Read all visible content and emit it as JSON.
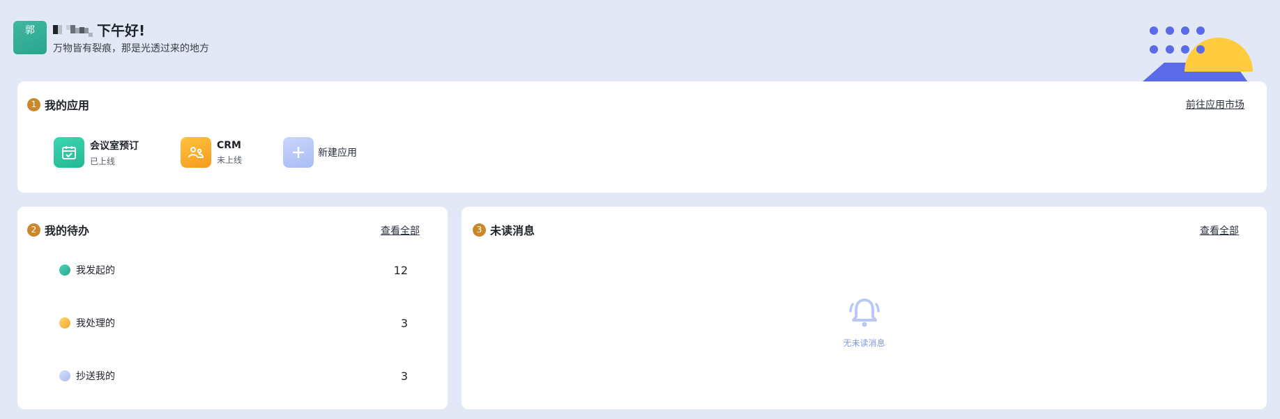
{
  "header": {
    "avatar_text": "郭",
    "greeting": "下午好!",
    "motto": "万物皆有裂痕，那是光透过来的地方"
  },
  "apps_section": {
    "number": "1",
    "title": "我的应用",
    "market_link": "前往应用市场",
    "apps": [
      {
        "name": "会议室预订",
        "status": "已上线",
        "icon": "calendar-check-icon",
        "color": "#2fc4a0"
      },
      {
        "name": "CRM",
        "status": "未上线",
        "icon": "users-icon",
        "color": "#f7a728"
      }
    ],
    "new_app_label": "新建应用"
  },
  "todo_section": {
    "number": "2",
    "title": "我的待办",
    "view_all": "查看全部",
    "items": [
      {
        "label": "我发起的",
        "count": "12",
        "color": "#2fb59a"
      },
      {
        "label": "我处理的",
        "count": "3",
        "color": "#f1b53e"
      },
      {
        "label": "抄送我的",
        "count": "3",
        "color": "#b5c6f2"
      }
    ]
  },
  "message_section": {
    "number": "3",
    "title": "未读消息",
    "view_all": "查看全部",
    "empty_text": "无未读消息",
    "empty_icon": "bell-icon"
  },
  "colors": {
    "background": "#e2e8f6",
    "badge": "#c9892a",
    "accent_blue": "#5b6be8",
    "sun_yellow": "#ffcc3d"
  }
}
